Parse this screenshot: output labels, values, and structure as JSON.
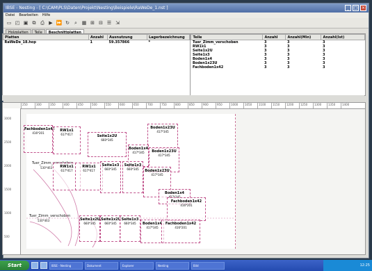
{
  "window": {
    "title": "IBSE - Nesting - [ C:\\CAM\\PLS\\Daten\\Projekt\\Nesting\\Beispiele\\RaWeDe_1.nst ]"
  },
  "menu": [
    "Datei",
    "Bearbeiten",
    "Hilfe"
  ],
  "tabs": [
    "Holzplatten",
    "Teile",
    "Beschnittplatten"
  ],
  "plates": {
    "headers": [
      "Platten",
      "Anzahl",
      "Ausnutzung",
      "Lagerbezeichnung"
    ],
    "rows": [
      [
        "RaWeDe_18.hop",
        "1",
        "59.357866",
        "*"
      ]
    ]
  },
  "parts": {
    "headers": [
      "Teile",
      "Anzahl",
      "Anzahl(Min)",
      "Anzahl(Ist)"
    ],
    "rows": [
      [
        "Tuer_Zimm_verschoben",
        "3",
        "3",
        "3"
      ],
      [
        "RW1x1",
        "3",
        "3",
        "3"
      ],
      [
        "Seite1x2U",
        "3",
        "3",
        "3"
      ],
      [
        "Seite1x3",
        "3",
        "3",
        "3"
      ],
      [
        "Boden1x4",
        "3",
        "3",
        "3"
      ],
      [
        "Boden1x23U",
        "3",
        "3",
        "3"
      ],
      [
        "Fachboden1x42",
        "3",
        "3",
        "3"
      ]
    ]
  },
  "ruler": {
    "h": [
      "250",
      "300",
      "350",
      "400",
      "450",
      "500",
      "550",
      "600",
      "650",
      "700",
      "750",
      "800",
      "850",
      "900",
      "950",
      "1000",
      "1050",
      "1100",
      "1150",
      "1200",
      "1250",
      "1300",
      "1350",
      "1400"
    ],
    "v": [
      "3000",
      "2500",
      "2000",
      "1500",
      "1000",
      "500"
    ]
  },
  "pieces": [
    {
      "name": "Fachboden1x42",
      "dim": "416*201"
    },
    {
      "name": "RW1x1",
      "dim": "617*417"
    },
    {
      "name": "Seite1x2U",
      "dim": "660*345"
    },
    {
      "name": "Boden1x23U",
      "dim": "417*345"
    },
    {
      "name": "Boden1x4",
      "dim": "417*345"
    },
    {
      "name": "Boden1x23U",
      "dim": "417*345"
    },
    {
      "name": "RW1x1",
      "dim": "617*417"
    },
    {
      "name": "RW1x1",
      "dim": "617*417"
    },
    {
      "name": "Seite1x3",
      "dim": "660*345"
    },
    {
      "name": "Seite1x3",
      "dim": "660*345"
    },
    {
      "name": "Boden1x23U",
      "dim": "417*345"
    },
    {
      "name": "Boden1x4",
      "dim": "417*345"
    },
    {
      "name": "Fachboden1x42",
      "dim": "416*201"
    },
    {
      "name": "Seite1x2U",
      "dim": "660*345"
    },
    {
      "name": "Seite1x2U",
      "dim": "660*345"
    },
    {
      "name": "Seite1x3",
      "dim": "660*345"
    },
    {
      "name": "Boden1x4",
      "dim": "417*345"
    },
    {
      "name": "Fachboden1x42",
      "dim": "416*201"
    }
  ],
  "free_labels": {
    "door1": "Tuer_Zimm_verschoben",
    "door1_dim": "530*463",
    "door2": "Tuer_Zimm_verschoben",
    "door2_dim": "530*463"
  },
  "taskbar": {
    "start": "Start",
    "tasks": [
      "IBSE - Nesting",
      "Dokument",
      "Explorer",
      "Nesting",
      "Bild"
    ],
    "clock": "12:25"
  }
}
